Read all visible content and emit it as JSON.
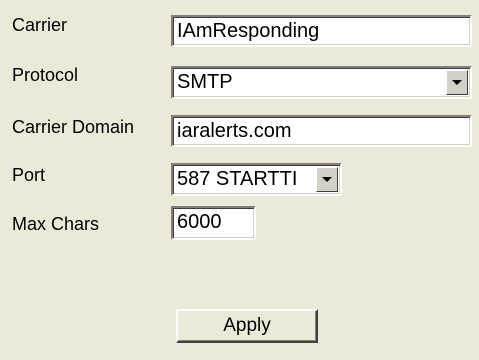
{
  "form": {
    "carrier": {
      "label": "Carrier",
      "value": "IAmResponding"
    },
    "protocol": {
      "label": "Protocol",
      "value": "SMTP"
    },
    "carrier_domain": {
      "label": "Carrier Domain",
      "value": "iaralerts.com"
    },
    "port": {
      "label": "Port",
      "value": "587 STARTTI"
    },
    "max_chars": {
      "label": "Max Chars",
      "value": "6000"
    }
  },
  "apply_button": {
    "label": "Apply"
  },
  "icons": {
    "dropdown": "chevron-down-icon"
  }
}
